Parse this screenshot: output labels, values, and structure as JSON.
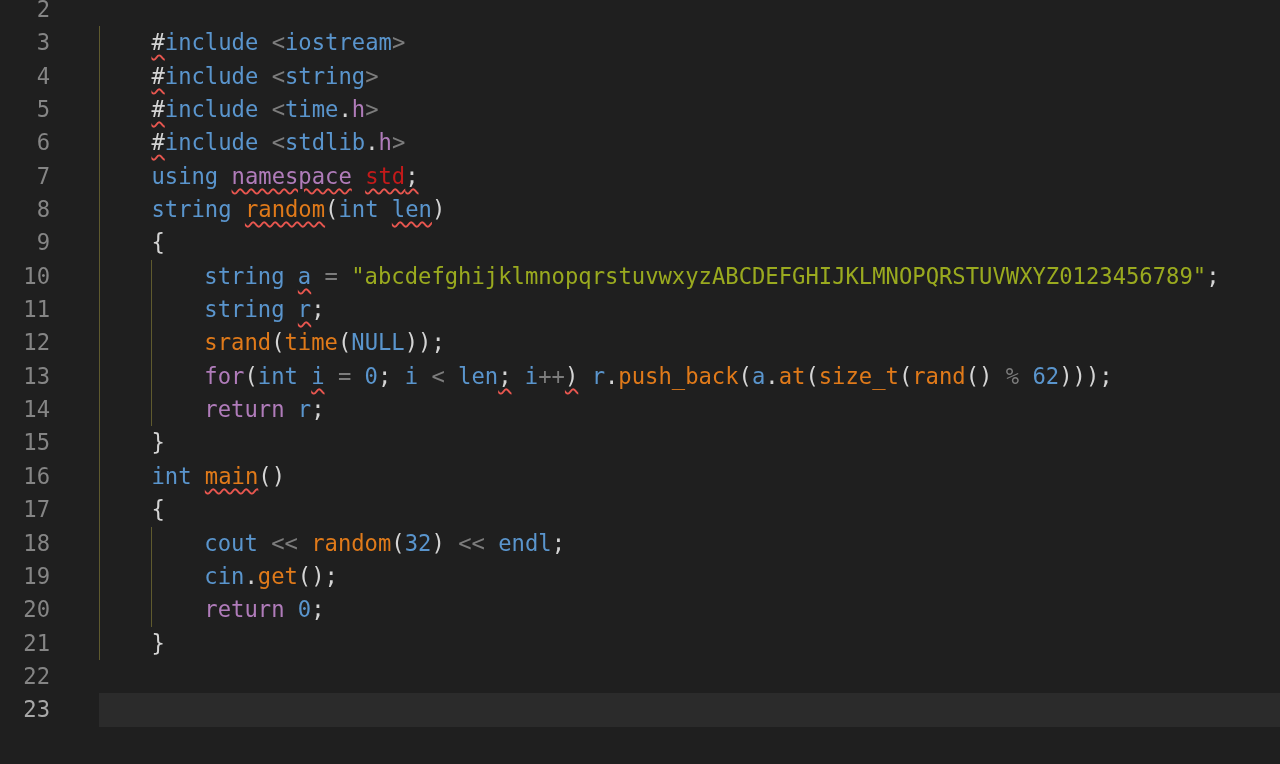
{
  "lines": [
    {
      "kind": "line",
      "n": "2",
      "current": false
    },
    {
      "kind": "block",
      "children": [
        {
          "kind": "line",
          "n": "3",
          "current": false,
          "tokens": [
            {
              "t": "#",
              "kind": "punct",
              "sp": false,
              "sq": true
            },
            {
              "t": "include",
              "kind": "kw",
              "sp": false,
              "sq": false
            },
            {
              "t": "<",
              "kind": "op",
              "sp": true,
              "sq": false
            },
            {
              "t": "iostream",
              "kind": "kw",
              "sp": false,
              "sq": false
            },
            {
              "t": ">",
              "kind": "op",
              "sp": false,
              "sq": false
            }
          ]
        },
        {
          "kind": "line",
          "n": "4",
          "current": false,
          "tokens": [
            {
              "t": "#",
              "kind": "punct",
              "sp": false,
              "sq": true
            },
            {
              "t": "include",
              "kind": "kw",
              "sp": false,
              "sq": false
            },
            {
              "t": "<",
              "kind": "op",
              "sp": true,
              "sq": false
            },
            {
              "t": "string",
              "kind": "kw",
              "sp": false,
              "sq": false
            },
            {
              "t": ">",
              "kind": "op",
              "sp": false,
              "sq": false
            }
          ]
        },
        {
          "kind": "line",
          "n": "5",
          "current": false,
          "tokens": [
            {
              "t": "#",
              "kind": "punct",
              "sp": false,
              "sq": true
            },
            {
              "t": "include",
              "kind": "kw",
              "sp": false,
              "sq": false
            },
            {
              "t": "<",
              "kind": "op",
              "sp": true,
              "sq": false
            },
            {
              "t": "time",
              "kind": "kw",
              "sp": false,
              "sq": false
            },
            {
              "t": ".",
              "kind": "punct",
              "sp": false,
              "sq": false
            },
            {
              "t": "h",
              "kind": "ctrl",
              "sp": false,
              "sq": false
            },
            {
              "t": ">",
              "kind": "op",
              "sp": false,
              "sq": false
            }
          ]
        },
        {
          "kind": "line",
          "n": "6",
          "current": false,
          "tokens": [
            {
              "t": "#",
              "kind": "punct",
              "sp": false,
              "sq": true
            },
            {
              "t": "include",
              "kind": "kw",
              "sp": false,
              "sq": false
            },
            {
              "t": "<",
              "kind": "op",
              "sp": true,
              "sq": false
            },
            {
              "t": "stdlib",
              "kind": "kw",
              "sp": false,
              "sq": false
            },
            {
              "t": ".",
              "kind": "punct",
              "sp": false,
              "sq": false
            },
            {
              "t": "h",
              "kind": "ctrl",
              "sp": false,
              "sq": false
            },
            {
              "t": ">",
              "kind": "op",
              "sp": false,
              "sq": false
            }
          ]
        },
        {
          "kind": "line",
          "n": "7",
          "current": false,
          "tokens": [
            {
              "t": "using",
              "kind": "kw",
              "sp": false,
              "sq": false
            },
            {
              "t": "namespace",
              "kind": "ctrl",
              "sp": true,
              "sq": true
            },
            {
              "t": "std",
              "kind": "ns",
              "sp": true,
              "sq": true
            },
            {
              "t": ";",
              "kind": "punct",
              "sp": false,
              "sq": true
            }
          ]
        },
        {
          "kind": "line",
          "n": "8",
          "current": false,
          "tokens": [
            {
              "t": "string",
              "kind": "kw",
              "sp": false,
              "sq": false
            },
            {
              "t": "random",
              "kind": "fn",
              "sp": true,
              "sq": true
            },
            {
              "t": "(",
              "kind": "punct",
              "sp": false,
              "sq": false
            },
            {
              "t": "int",
              "kind": "kw",
              "sp": false,
              "sq": false
            },
            {
              "t": "len",
              "kind": "kw",
              "sp": true,
              "sq": true
            },
            {
              "t": ")",
              "kind": "punct",
              "sp": false,
              "sq": false
            }
          ]
        },
        {
          "kind": "line",
          "n": "9",
          "current": false,
          "tokens": [
            {
              "t": "{",
              "kind": "punct",
              "sp": false,
              "sq": false
            }
          ]
        },
        {
          "kind": "block",
          "children": [
            {
              "kind": "line",
              "n": "10",
              "current": false,
              "tokens": [
                {
                  "t": "string",
                  "kind": "kw",
                  "sp": false,
                  "sq": false
                },
                {
                  "t": "a",
                  "kind": "kw",
                  "sp": true,
                  "sq": true
                },
                {
                  "t": "=",
                  "kind": "op",
                  "sp": true,
                  "sq": false
                },
                {
                  "t": "\"abcdefghijklmnopqrstuvwxyzABCDEFGHIJKLMNOPQRSTUVWXYZ0123456789\"",
                  "kind": "str",
                  "sp": true,
                  "sq": false
                },
                {
                  "t": ";",
                  "kind": "punct",
                  "sp": false,
                  "sq": false
                }
              ]
            },
            {
              "kind": "line",
              "n": "11",
              "current": false,
              "tokens": [
                {
                  "t": "string",
                  "kind": "kw",
                  "sp": false,
                  "sq": false
                },
                {
                  "t": "r",
                  "kind": "kw",
                  "sp": true,
                  "sq": true
                },
                {
                  "t": ";",
                  "kind": "punct",
                  "sp": false,
                  "sq": false
                }
              ]
            },
            {
              "kind": "line",
              "n": "12",
              "current": false,
              "tokens": [
                {
                  "t": "srand",
                  "kind": "fn",
                  "sp": false,
                  "sq": false
                },
                {
                  "t": "(",
                  "kind": "punct",
                  "sp": false,
                  "sq": false
                },
                {
                  "t": "time",
                  "kind": "fn",
                  "sp": false,
                  "sq": false
                },
                {
                  "t": "(",
                  "kind": "punct",
                  "sp": false,
                  "sq": false
                },
                {
                  "t": "NULL",
                  "kind": "kw",
                  "sp": false,
                  "sq": false
                },
                {
                  "t": "));",
                  "kind": "punct",
                  "sp": false,
                  "sq": false
                }
              ]
            },
            {
              "kind": "line",
              "n": "13",
              "current": false,
              "tokens": [
                {
                  "t": "for",
                  "kind": "ctrl",
                  "sp": false,
                  "sq": false
                },
                {
                  "t": "(",
                  "kind": "punct",
                  "sp": false,
                  "sq": false
                },
                {
                  "t": "int",
                  "kind": "kw",
                  "sp": false,
                  "sq": false
                },
                {
                  "t": "i",
                  "kind": "kw",
                  "sp": true,
                  "sq": true
                },
                {
                  "t": "=",
                  "kind": "op",
                  "sp": true,
                  "sq": false
                },
                {
                  "t": "0",
                  "kind": "kw",
                  "sp": true,
                  "sq": false
                },
                {
                  "t": ";",
                  "kind": "punct",
                  "sp": false,
                  "sq": false
                },
                {
                  "t": "i",
                  "kind": "kw",
                  "sp": true,
                  "sq": false
                },
                {
                  "t": "<",
                  "kind": "op",
                  "sp": true,
                  "sq": false
                },
                {
                  "t": "len",
                  "kind": "kw",
                  "sp": true,
                  "sq": false
                },
                {
                  "t": ";",
                  "kind": "punct",
                  "sp": false,
                  "sq": true
                },
                {
                  "t": "i",
                  "kind": "kw",
                  "sp": true,
                  "sq": false
                },
                {
                  "t": "++",
                  "kind": "op",
                  "sp": false,
                  "sq": false
                },
                {
                  "t": ")",
                  "kind": "punct",
                  "sp": false,
                  "sq": true
                },
                {
                  "t": "r",
                  "kind": "kw",
                  "sp": true,
                  "sq": false
                },
                {
                  "t": ".",
                  "kind": "punct",
                  "sp": false,
                  "sq": false
                },
                {
                  "t": "push_back",
                  "kind": "fn",
                  "sp": false,
                  "sq": false
                },
                {
                  "t": "(",
                  "kind": "punct",
                  "sp": false,
                  "sq": false
                },
                {
                  "t": "a",
                  "kind": "kw",
                  "sp": false,
                  "sq": false
                },
                {
                  "t": ".",
                  "kind": "punct",
                  "sp": false,
                  "sq": false
                },
                {
                  "t": "at",
                  "kind": "fn",
                  "sp": false,
                  "sq": false
                },
                {
                  "t": "(",
                  "kind": "punct",
                  "sp": false,
                  "sq": false
                },
                {
                  "t": "size_t",
                  "kind": "fn",
                  "sp": false,
                  "sq": false
                },
                {
                  "t": "(",
                  "kind": "punct",
                  "sp": false,
                  "sq": false
                },
                {
                  "t": "rand",
                  "kind": "fn",
                  "sp": false,
                  "sq": false
                },
                {
                  "t": "()",
                  "kind": "punct",
                  "sp": false,
                  "sq": false
                },
                {
                  "t": "%",
                  "kind": "op",
                  "sp": true,
                  "sq": false
                },
                {
                  "t": "62",
                  "kind": "kw",
                  "sp": true,
                  "sq": false
                },
                {
                  "t": ")));",
                  "kind": "punct",
                  "sp": false,
                  "sq": false
                }
              ]
            },
            {
              "kind": "line",
              "n": "14",
              "current": false,
              "tokens": [
                {
                  "t": "return",
                  "kind": "ctrl",
                  "sp": false,
                  "sq": false
                },
                {
                  "t": "r",
                  "kind": "kw",
                  "sp": true,
                  "sq": false
                },
                {
                  "t": ";",
                  "kind": "punct",
                  "sp": false,
                  "sq": false
                }
              ]
            }
          ]
        },
        {
          "kind": "line",
          "n": "15",
          "current": false,
          "tokens": [
            {
              "t": "}",
              "kind": "punct",
              "sp": false,
              "sq": false
            }
          ]
        },
        {
          "kind": "line",
          "n": "16",
          "current": false,
          "tokens": [
            {
              "t": "int",
              "kind": "kw",
              "sp": false,
              "sq": false
            },
            {
              "t": "main",
              "kind": "fn",
              "sp": true,
              "sq": true
            },
            {
              "t": "()",
              "kind": "punct",
              "sp": false,
              "sq": false
            }
          ]
        },
        {
          "kind": "line",
          "n": "17",
          "current": false,
          "tokens": [
            {
              "t": "{",
              "kind": "punct",
              "sp": false,
              "sq": false
            }
          ]
        },
        {
          "kind": "block",
          "children": [
            {
              "kind": "line",
              "n": "18",
              "current": false,
              "tokens": [
                {
                  "t": "cout",
                  "kind": "kw",
                  "sp": false,
                  "sq": false
                },
                {
                  "t": "<<",
                  "kind": "op",
                  "sp": true,
                  "sq": false
                },
                {
                  "t": "random",
                  "kind": "fn",
                  "sp": true,
                  "sq": false
                },
                {
                  "t": "(",
                  "kind": "punct",
                  "sp": false,
                  "sq": false
                },
                {
                  "t": "32",
                  "kind": "kw",
                  "sp": false,
                  "sq": false
                },
                {
                  "t": ")",
                  "kind": "punct",
                  "sp": false,
                  "sq": false
                },
                {
                  "t": "<<",
                  "kind": "op",
                  "sp": true,
                  "sq": false
                },
                {
                  "t": "endl",
                  "kind": "kw",
                  "sp": true,
                  "sq": false
                },
                {
                  "t": ";",
                  "kind": "punct",
                  "sp": false,
                  "sq": false
                }
              ]
            },
            {
              "kind": "line",
              "n": "19",
              "current": false,
              "tokens": [
                {
                  "t": "cin",
                  "kind": "kw",
                  "sp": false,
                  "sq": false
                },
                {
                  "t": ".",
                  "kind": "punct",
                  "sp": false,
                  "sq": false
                },
                {
                  "t": "get",
                  "kind": "fn",
                  "sp": false,
                  "sq": false
                },
                {
                  "t": "();",
                  "kind": "punct",
                  "sp": false,
                  "sq": false
                }
              ]
            },
            {
              "kind": "line",
              "n": "20",
              "current": false,
              "tokens": [
                {
                  "t": "return",
                  "kind": "ctrl",
                  "sp": false,
                  "sq": false
                },
                {
                  "t": "0",
                  "kind": "kw",
                  "sp": true,
                  "sq": false
                },
                {
                  "t": ";",
                  "kind": "punct",
                  "sp": false,
                  "sq": false
                }
              ]
            }
          ]
        },
        {
          "kind": "line",
          "n": "21",
          "current": false,
          "tokens": [
            {
              "t": "}",
              "kind": "punct",
              "sp": false,
              "sq": false
            }
          ]
        }
      ]
    },
    {
      "kind": "line",
      "n": "22",
      "current": false
    },
    {
      "kind": "line",
      "n": "23",
      "current": true
    }
  ]
}
